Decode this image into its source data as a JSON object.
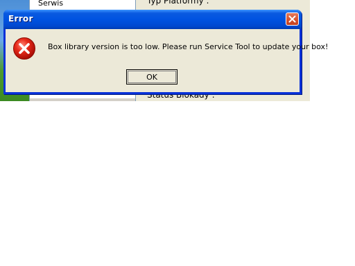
{
  "background_app": {
    "sidebar": {
      "items": [
        {
          "label": "Serwis"
        }
      ]
    },
    "main": {
      "field_top_label": "Typ Platformy :",
      "field_bottom_label": "Status Blokady :"
    }
  },
  "dialog": {
    "title": "Error",
    "icon": "error-icon",
    "message": "Box library version is too low. Please run Service Tool to update your box!",
    "ok_label": "OK",
    "close_icon": "close-icon"
  },
  "colors": {
    "titlebar_blue": "#0053e1",
    "close_red": "#d6502c",
    "dialog_face": "#ece9d8",
    "error_red": "#e02020"
  }
}
